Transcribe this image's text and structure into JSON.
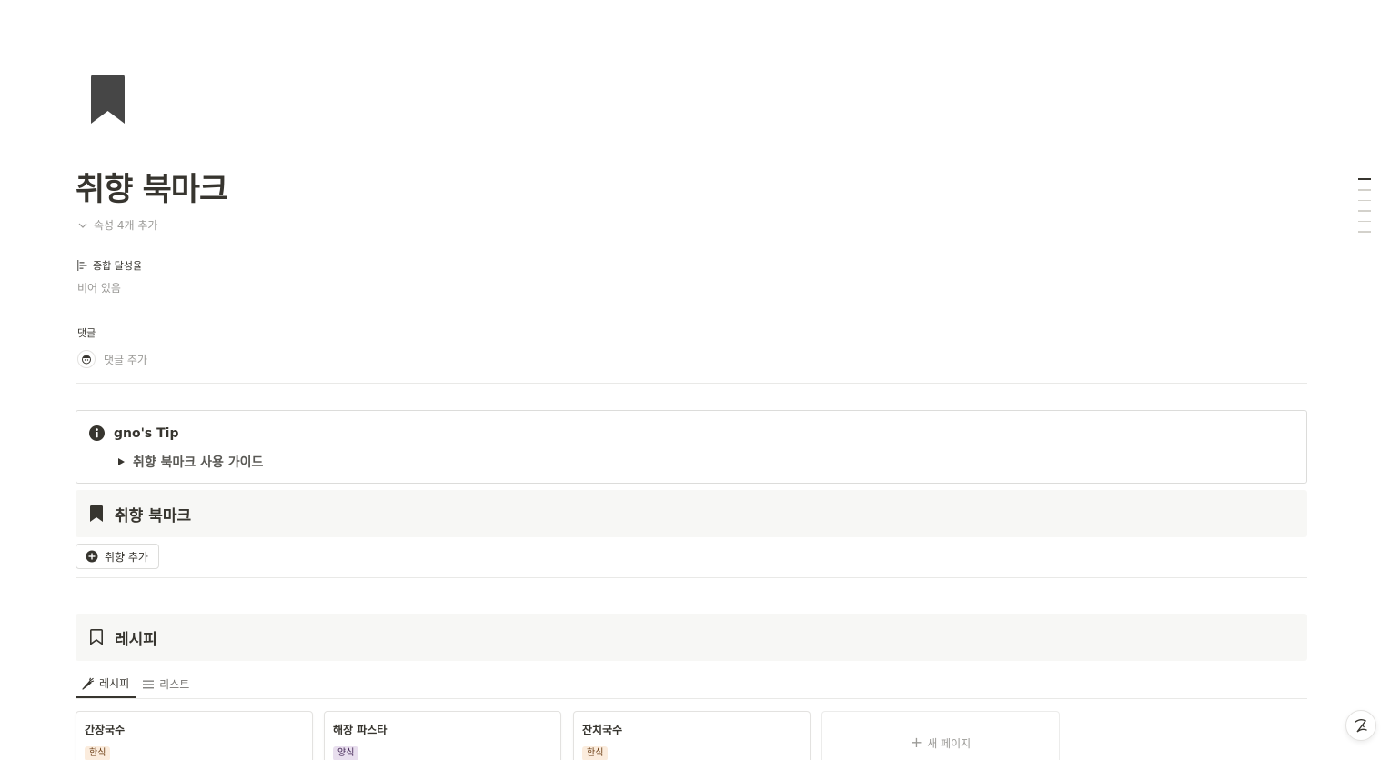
{
  "page": {
    "icon": "bookmark-icon",
    "title": "취향 북마크",
    "properties_toggle": "속성 4개 추가"
  },
  "property": {
    "label": "종합 달성율",
    "value": "비어 있음"
  },
  "comments": {
    "label": "댓글",
    "placeholder": "댓글 추가"
  },
  "callout": {
    "icon": "info-icon",
    "title": "gno's Tip",
    "toggle_label": "취향 북마크 사용 가이드"
  },
  "bookmark_section": {
    "icon": "bookmark-icon",
    "title": "취향 북마크",
    "add_button": "취향 추가"
  },
  "recipe_section": {
    "icon": "bookmark-outline-icon",
    "title": "레시피",
    "tabs": [
      {
        "label": "레시피",
        "icon": "carrot-icon",
        "active": true
      },
      {
        "label": "리스트",
        "icon": "list-icon",
        "active": false
      }
    ],
    "cards": [
      {
        "title": "간장국수",
        "tag": "한식",
        "tag_bg": "#fbecdd",
        "tag_color": "#6b3d14"
      },
      {
        "title": "해장 파스타",
        "tag": "양식",
        "tag_bg": "#e8deee",
        "tag_color": "#412454"
      },
      {
        "title": "잔치국수",
        "tag": "한식",
        "tag_bg": "#fbecdd",
        "tag_color": "#6b3d14"
      }
    ],
    "new_page": "새 페이지"
  },
  "help": {
    "label": "?",
    "icon": "help-icon"
  },
  "colors": {
    "text": "#37352f",
    "muted": "#9b9a97",
    "section_bg": "#f7f7f5",
    "border": "#dcdcda"
  }
}
